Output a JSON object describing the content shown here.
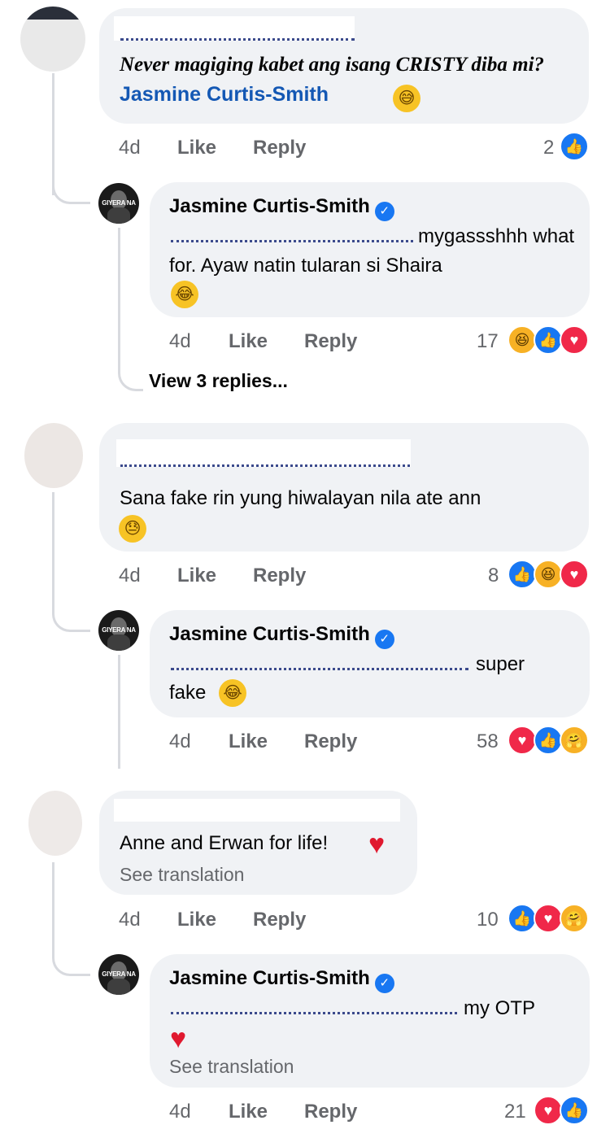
{
  "comments": [
    {
      "author": "",
      "text_pre": "Never magiging kabet ang isang CRISTY diba mi?",
      "mention": "Jasmine Curtis-Smith",
      "emoji": "grinning-sweat-emoji",
      "time": "4d",
      "like": "Like",
      "reply": "Reply",
      "reaction_count": "2",
      "reactions": [
        "like"
      ],
      "reply_comment": {
        "author": "Jasmine Curtis-Smith",
        "avatar_text": "GIYERA NA",
        "text": "mygassshhh what for. Ayaw natin tularan si Shaira",
        "emoji": "laughing-tears-emoji",
        "time": "4d",
        "like": "Like",
        "reply": "Reply",
        "reaction_count": "17",
        "reactions": [
          "haha",
          "like",
          "love"
        ]
      },
      "view_replies": "View 3 replies..."
    },
    {
      "author": "",
      "text": "Sana fake rin yung hiwalayan nila ate ann",
      "emoji": "downcast-sweat-emoji",
      "time": "4d",
      "like": "Like",
      "reply": "Reply",
      "reaction_count": "8",
      "reactions": [
        "like",
        "haha",
        "love"
      ],
      "reply_comment": {
        "author": "Jasmine Curtis-Smith",
        "avatar_text": "GIYERA NA",
        "text_1": "super",
        "text_2": "fake",
        "emoji": "laughing-tears-emoji",
        "time": "4d",
        "like": "Like",
        "reply": "Reply",
        "reaction_count": "58",
        "reactions": [
          "love",
          "like",
          "care"
        ]
      }
    },
    {
      "author": "",
      "text": "Anne and Erwan for life!",
      "emoji": "red-heart-emoji",
      "see_translation": "See translation",
      "time": "4d",
      "like": "Like",
      "reply": "Reply",
      "reaction_count": "10",
      "reactions": [
        "like",
        "love",
        "care"
      ],
      "reply_comment": {
        "author": "Jasmine Curtis-Smith",
        "avatar_text": "GIYERA NA",
        "text": "my OTP",
        "emoji": "red-heart-emoji",
        "see_translation": "See translation",
        "time": "4d",
        "like": "Like",
        "reply": "Reply",
        "reaction_count": "21",
        "reactions": [
          "love",
          "like"
        ]
      }
    }
  ],
  "colors": {
    "bubble": "#f0f2f5",
    "meta": "#65676b",
    "mention": "#1458b4",
    "like": "#1877f2",
    "love": "#f02849",
    "haha": "#f7b125"
  }
}
